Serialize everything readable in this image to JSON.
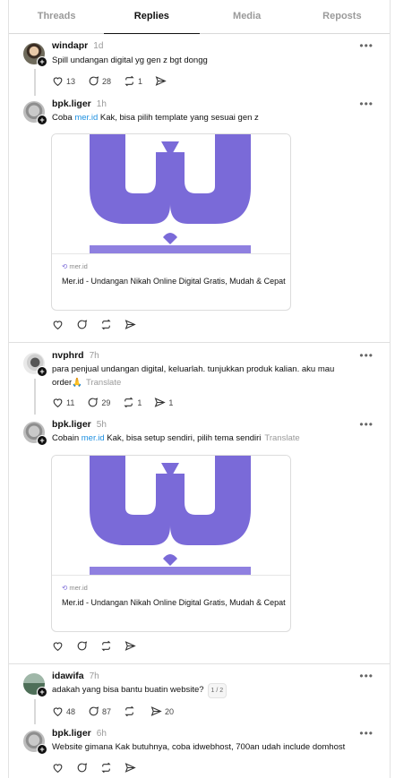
{
  "tabs": [
    "Threads",
    "Replies",
    "Media",
    "Reposts"
  ],
  "active_tab": "Replies",
  "colors": {
    "link": "#1d8fe0",
    "logo": "#7a6ad8"
  },
  "groups": [
    {
      "parent": {
        "user": "windapr",
        "time": "1d",
        "text": "Spill undangan digital yg gen z bgt dongg",
        "likes": "13",
        "replies": "28",
        "reposts": "1",
        "shares": ""
      },
      "reply": {
        "user": "bpk.liger",
        "time": "1h",
        "pre": "Coba ",
        "link": "mer.id",
        "post": " Kak, bisa pilih template yang sesuai gen z",
        "translate": "",
        "card": {
          "domain": "mer.id",
          "title": "Mer.id - Undangan Nikah Online Digital Gratis, Mudah & Cepat"
        }
      }
    },
    {
      "parent": {
        "user": "nvphrd",
        "time": "7h",
        "text": "para penjual undangan digital, keluarlah. tunjukkan produk kalian. aku mau order🙏",
        "translate": "Translate",
        "likes": "11",
        "replies": "29",
        "reposts": "1",
        "shares": "1"
      },
      "reply": {
        "user": "bpk.liger",
        "time": "5h",
        "pre": "Cobain ",
        "link": "mer.id",
        "post": " Kak, bisa setup sendiri, pilih tema sendiri",
        "translate": "Translate",
        "card": {
          "domain": "mer.id",
          "title": "Mer.id - Undangan Nikah Online Digital Gratis, Mudah & Cepat"
        }
      }
    },
    {
      "parent": {
        "user": "idawifa",
        "time": "7h",
        "text": "adakah yang bisa bantu buatin website?",
        "counter": "1 / 2",
        "likes": "48",
        "replies": "87",
        "reposts": "",
        "shares": "20"
      },
      "reply": {
        "user": "bpk.liger",
        "time": "6h",
        "pre": "Website gimana Kak butuhnya, coba idwebhost, 700an udah include domhost",
        "link": "",
        "post": "",
        "translate": ""
      }
    }
  ]
}
